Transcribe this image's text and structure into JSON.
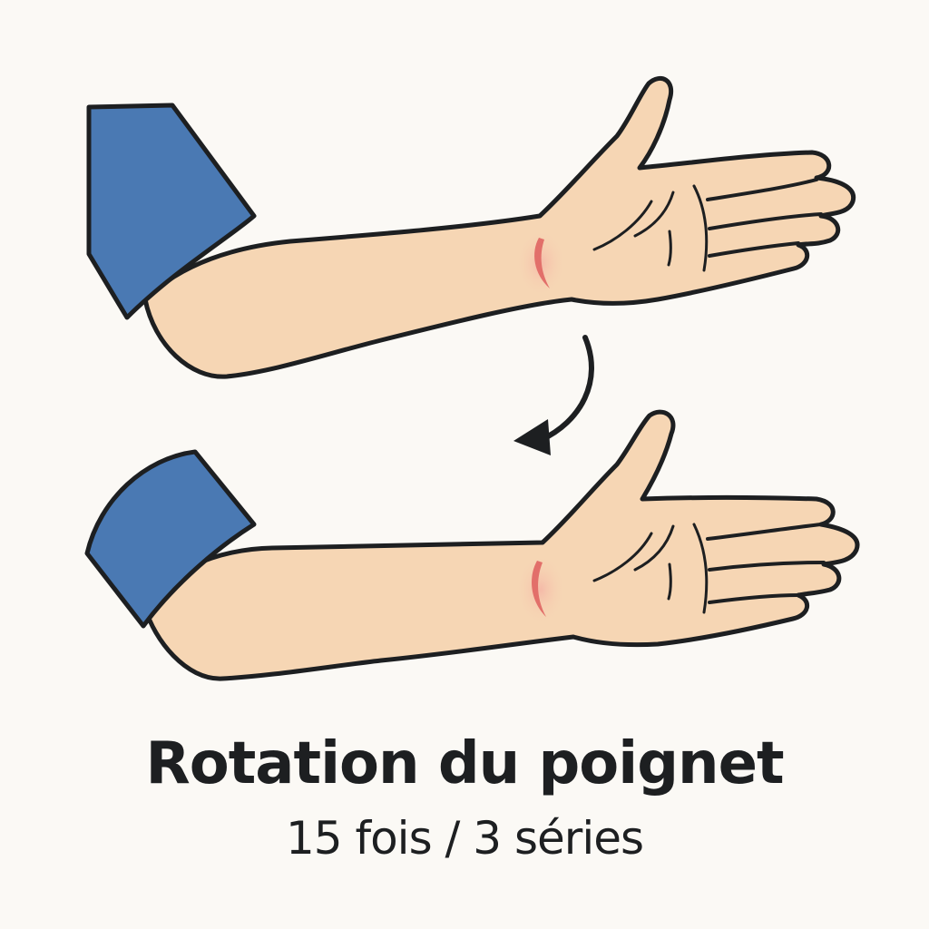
{
  "title": "Rotation du poignet",
  "subtitle": "15 fois / 3 séries",
  "colors": {
    "background": "#fbf9f5",
    "skin": "#f6d6b4",
    "sleeve": "#4a79b3",
    "outline": "#1d1f21",
    "pain_mark": "#e26f6a",
    "text": "#1d1f21"
  },
  "illustration": {
    "top_arm": "arm-palm-up-before",
    "rotation_arrow": "curved-arrow-down-left-icon",
    "bottom_arm": "arm-palm-up-after"
  }
}
